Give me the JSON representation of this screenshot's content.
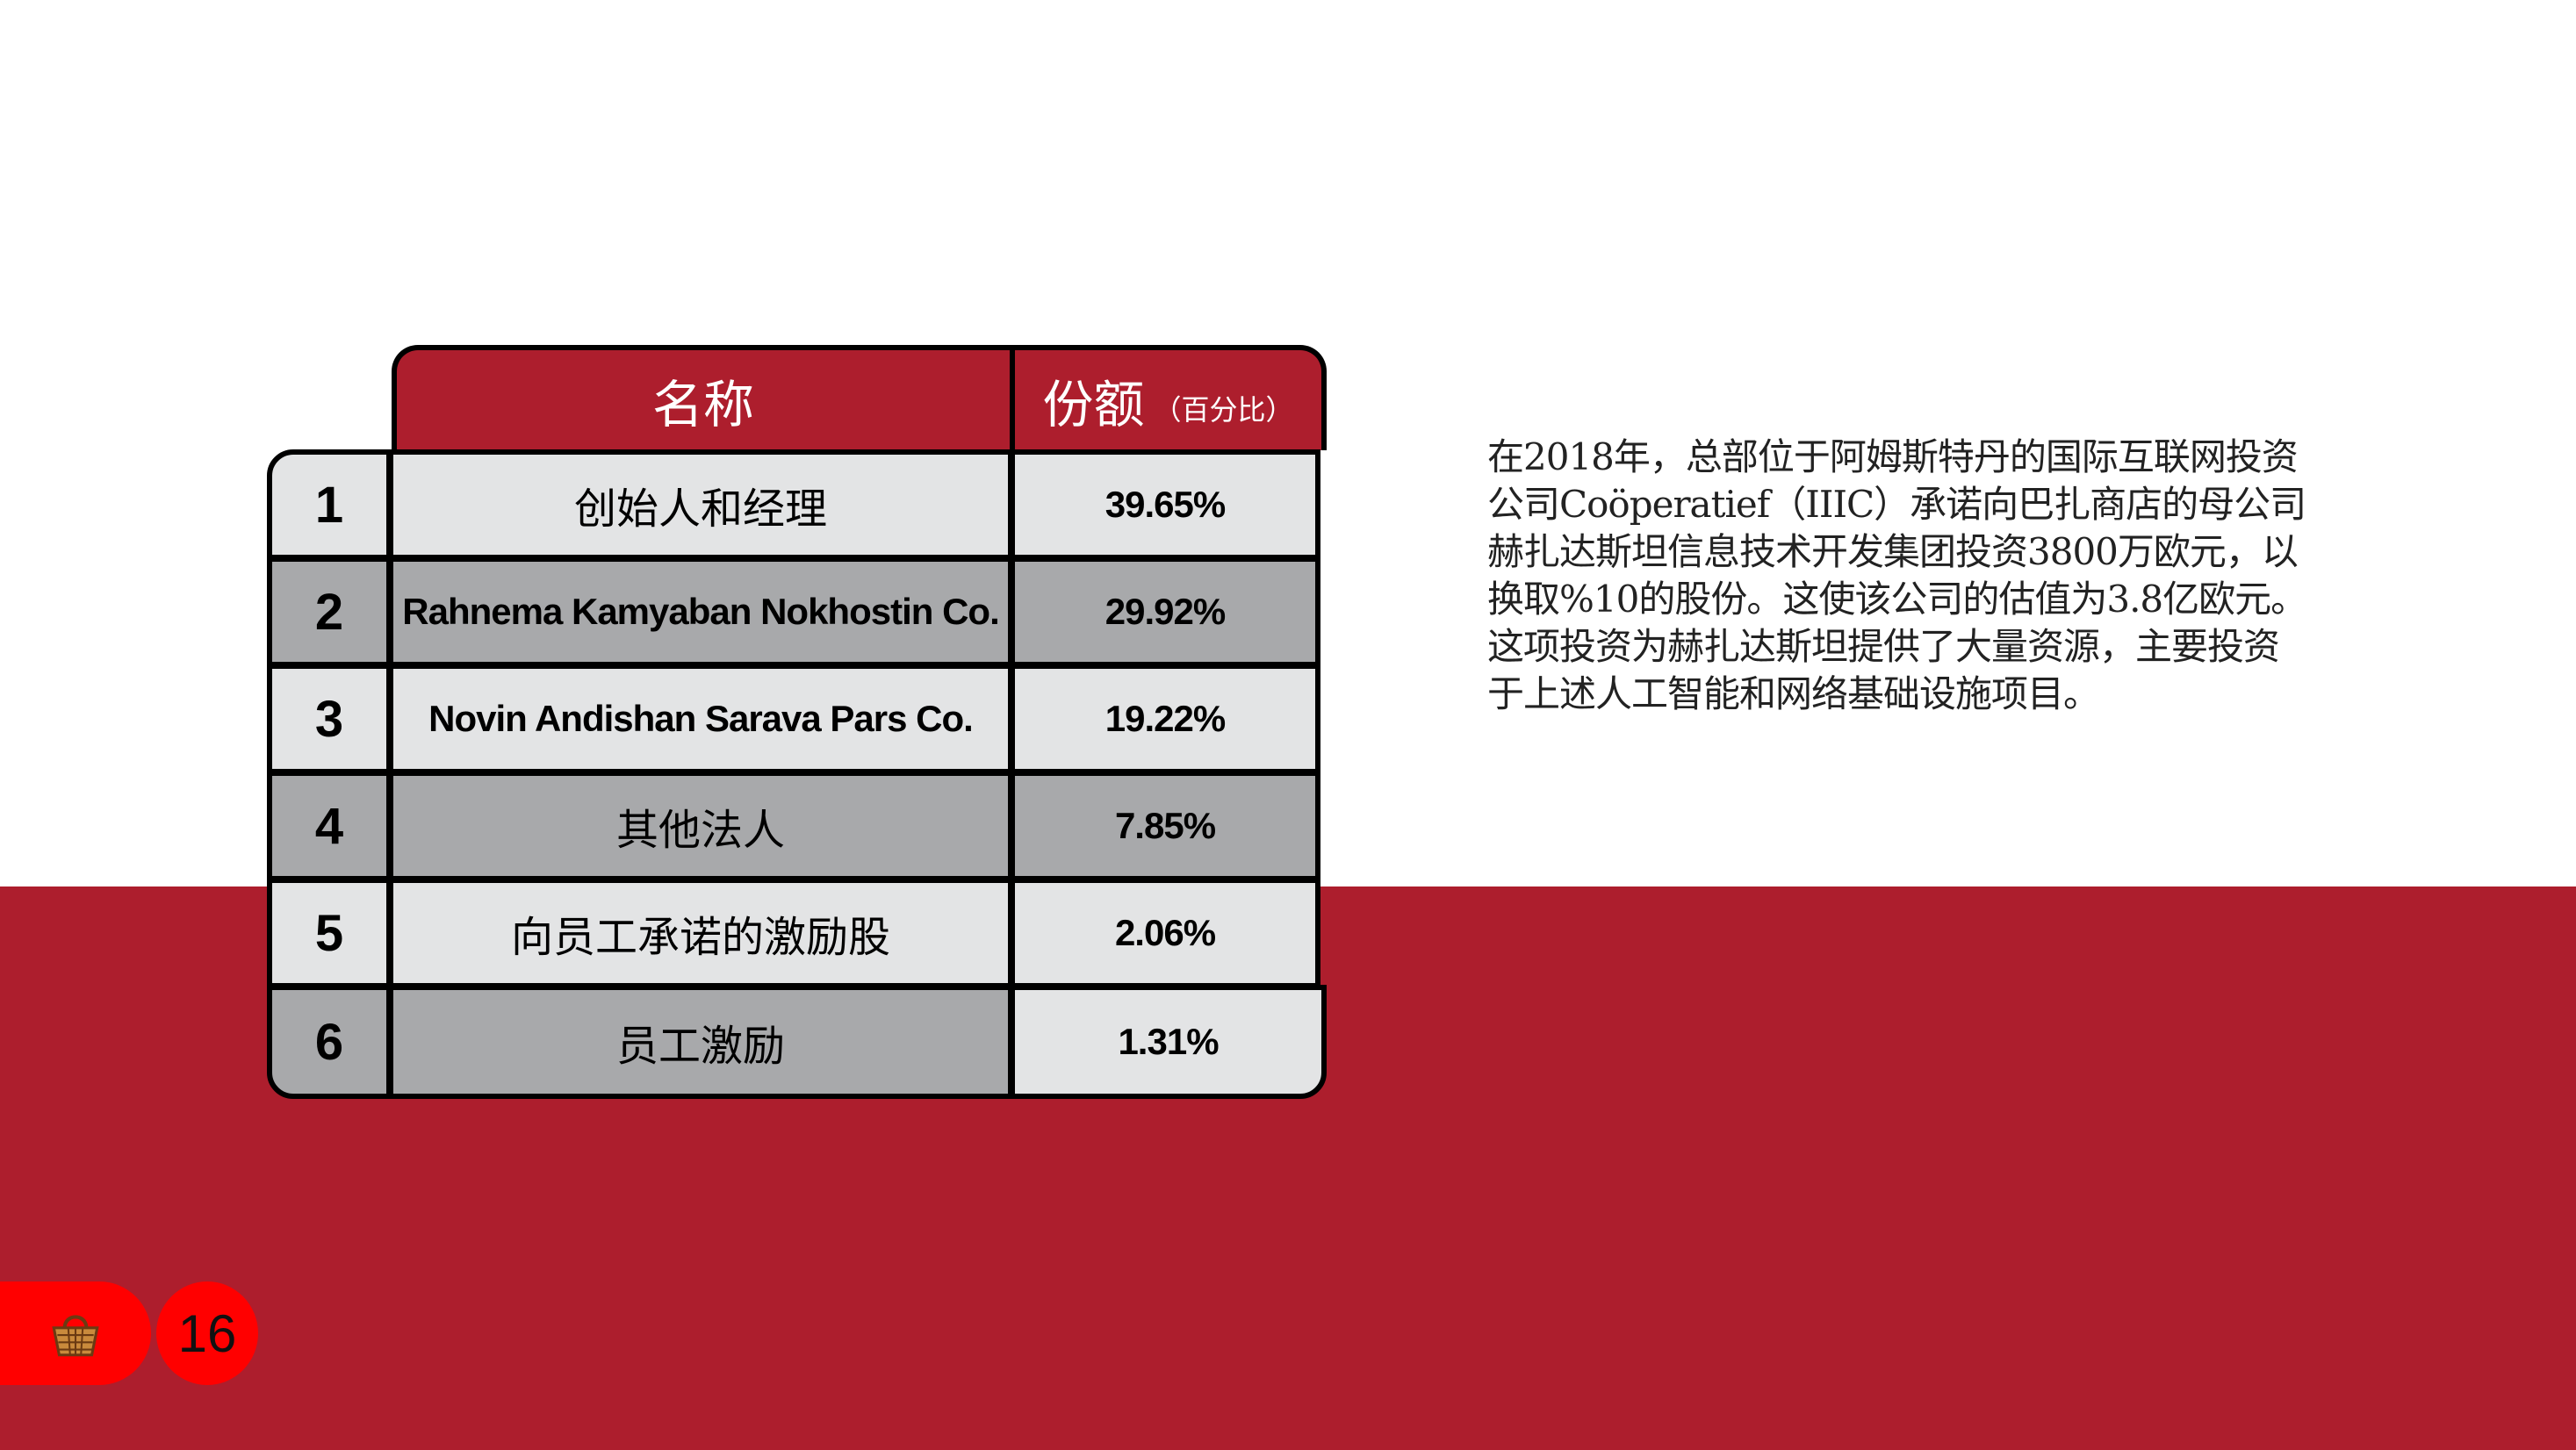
{
  "table": {
    "header_name": "名称",
    "header_share": "份额",
    "header_share_sub": "（百分比）",
    "rows": [
      {
        "rank": "1",
        "name": "创始人和经理",
        "share": "39.65%"
      },
      {
        "rank": "2",
        "name": "Rahnema Kamyaban Nokhostin Co.",
        "share": "29.92%"
      },
      {
        "rank": "3",
        "name": "Novin Andishan Sarava Pars Co.",
        "share": "19.22%"
      },
      {
        "rank": "4",
        "name": "其他法人",
        "share": "7.85%"
      },
      {
        "rank": "5",
        "name": "向员工承诺的激励股",
        "share": "2.06%"
      },
      {
        "rank": "6",
        "name": "员工激励",
        "share": "1.31%"
      }
    ]
  },
  "paragraph": "在2018年，总部位于阿姆斯特丹的国际互联网投资公司Coöperatief（IIIC）承诺向巴扎商店的母公司赫扎达斯坦信息技术开发集团投资3800万欧元，以换取%10的股份。这使该公司的估值为3.8亿欧元。这项投资为赫扎达斯坦提供了大量资源，主要投资于上述人工智能和网络基础设施项目。",
  "footer": {
    "icon": "basket-icon",
    "page_number": "16"
  },
  "colors": {
    "brand_red": "#ad1e2d",
    "badge_red": "#ff0000",
    "row_light": "#e3e4e5",
    "row_dark": "#a8a9ab"
  }
}
